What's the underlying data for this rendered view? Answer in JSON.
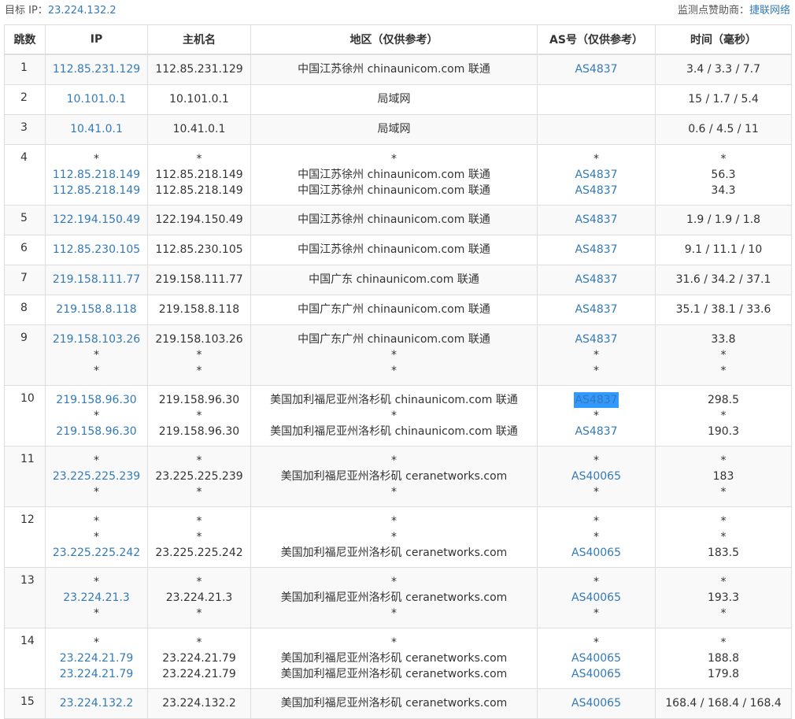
{
  "header": {
    "target_label": "目标 IP：",
    "target_ip": "23.224.132.2",
    "sponsor_label": "监测点赞助商：",
    "sponsor_name": "捷联网络"
  },
  "columns": {
    "hop": "跳数",
    "ip": "IP",
    "host": "主机名",
    "region": "地区（仅供参考）",
    "as": "AS号（仅供参考）",
    "time": "时间（毫秒）"
  },
  "colors": {
    "link": "#337ab7",
    "highlight": "#3399ff",
    "stripe": "#f9f9f9",
    "border": "#dddddd"
  },
  "rows": [
    {
      "hop": "1",
      "lines": [
        {
          "ip": "112.85.231.129",
          "host": "112.85.231.129",
          "region": "中国江苏徐州 chinaunicom.com 联通",
          "as": "AS4837",
          "time": "3.4 / 3.3 / 7.7"
        }
      ]
    },
    {
      "hop": "2",
      "lines": [
        {
          "ip": "10.101.0.1",
          "host": "10.101.0.1",
          "region": "局域网",
          "as": "",
          "time": "15 / 1.7 / 5.4"
        }
      ]
    },
    {
      "hop": "3",
      "lines": [
        {
          "ip": "10.41.0.1",
          "host": "10.41.0.1",
          "region": "局域网",
          "as": "",
          "time": "0.6 / 4.5 / 11"
        }
      ]
    },
    {
      "hop": "4",
      "lines": [
        {
          "ip": "*",
          "host": "*",
          "region": "*",
          "as": "*",
          "time": "*"
        },
        {
          "ip": "112.85.218.149",
          "host": "112.85.218.149",
          "region": "中国江苏徐州 chinaunicom.com 联通",
          "as": "AS4837",
          "time": "56.3"
        },
        {
          "ip": "112.85.218.149",
          "host": "112.85.218.149",
          "region": "中国江苏徐州 chinaunicom.com 联通",
          "as": "AS4837",
          "time": "34.3"
        }
      ]
    },
    {
      "hop": "5",
      "lines": [
        {
          "ip": "122.194.150.49",
          "host": "122.194.150.49",
          "region": "中国江苏徐州 chinaunicom.com 联通",
          "as": "AS4837",
          "time": "1.9 / 1.9 / 1.8"
        }
      ]
    },
    {
      "hop": "6",
      "lines": [
        {
          "ip": "112.85.230.105",
          "host": "112.85.230.105",
          "region": "中国江苏徐州 chinaunicom.com 联通",
          "as": "AS4837",
          "time": "9.1 / 11.1 / 10"
        }
      ]
    },
    {
      "hop": "7",
      "lines": [
        {
          "ip": "219.158.111.77",
          "host": "219.158.111.77",
          "region": "中国广东 chinaunicom.com 联通",
          "as": "AS4837",
          "time": "31.6 / 34.2 / 37.1"
        }
      ]
    },
    {
      "hop": "8",
      "lines": [
        {
          "ip": "219.158.8.118",
          "host": "219.158.8.118",
          "region": "中国广东广州 chinaunicom.com 联通",
          "as": "AS4837",
          "time": "35.1 / 38.1 / 33.6"
        }
      ]
    },
    {
      "hop": "9",
      "lines": [
        {
          "ip": "219.158.103.26",
          "host": "219.158.103.26",
          "region": "中国广东广州 chinaunicom.com 联通",
          "as": "AS4837",
          "time": "33.8"
        },
        {
          "ip": "*",
          "host": "*",
          "region": "*",
          "as": "*",
          "time": "*"
        },
        {
          "ip": "*",
          "host": "*",
          "region": "*",
          "as": "*",
          "time": "*"
        }
      ]
    },
    {
      "hop": "10",
      "lines": [
        {
          "ip": "219.158.96.30",
          "host": "219.158.96.30",
          "region": "美国加利福尼亚州洛杉矶 chinaunicom.com 联通",
          "as": "AS4837",
          "as_selected": true,
          "time": "298.5"
        },
        {
          "ip": "*",
          "host": "*",
          "region": "*",
          "as": "*",
          "time": "*"
        },
        {
          "ip": "219.158.96.30",
          "host": "219.158.96.30",
          "region": "美国加利福尼亚州洛杉矶 chinaunicom.com 联通",
          "as": "AS4837",
          "time": "190.3"
        }
      ]
    },
    {
      "hop": "11",
      "lines": [
        {
          "ip": "*",
          "host": "*",
          "region": "*",
          "as": "*",
          "time": "*"
        },
        {
          "ip": "23.225.225.239",
          "host": "23.225.225.239",
          "region": "美国加利福尼亚州洛杉矶 ceranetworks.com",
          "as": "AS40065",
          "time": "183"
        },
        {
          "ip": "*",
          "host": "*",
          "region": "*",
          "as": "*",
          "time": "*"
        }
      ]
    },
    {
      "hop": "12",
      "lines": [
        {
          "ip": "*",
          "host": "*",
          "region": "*",
          "as": "*",
          "time": "*"
        },
        {
          "ip": "*",
          "host": "*",
          "region": "*",
          "as": "*",
          "time": "*"
        },
        {
          "ip": "23.225.225.242",
          "host": "23.225.225.242",
          "region": "美国加利福尼亚州洛杉矶 ceranetworks.com",
          "as": "AS40065",
          "time": "183.5"
        }
      ]
    },
    {
      "hop": "13",
      "lines": [
        {
          "ip": "*",
          "host": "*",
          "region": "*",
          "as": "*",
          "time": "*"
        },
        {
          "ip": "23.224.21.3",
          "host": "23.224.21.3",
          "region": "美国加利福尼亚州洛杉矶 ceranetworks.com",
          "as": "AS40065",
          "time": "193.3"
        },
        {
          "ip": "*",
          "host": "*",
          "region": "*",
          "as": "*",
          "time": "*"
        }
      ]
    },
    {
      "hop": "14",
      "lines": [
        {
          "ip": "*",
          "host": "*",
          "region": "*",
          "as": "*",
          "time": "*"
        },
        {
          "ip": "23.224.21.79",
          "host": "23.224.21.79",
          "region": "美国加利福尼亚州洛杉矶 ceranetworks.com",
          "as": "AS40065",
          "time": "188.8"
        },
        {
          "ip": "23.224.21.79",
          "host": "23.224.21.79",
          "region": "美国加利福尼亚州洛杉矶 ceranetworks.com",
          "as": "AS40065",
          "time": "179.8"
        }
      ]
    },
    {
      "hop": "15",
      "lines": [
        {
          "ip": "23.224.132.2",
          "host": "23.224.132.2",
          "region": "美国加利福尼亚州洛杉矶 ceranetworks.com",
          "as": "AS40065",
          "time": "168.4 / 168.4 / 168.4"
        }
      ]
    }
  ]
}
